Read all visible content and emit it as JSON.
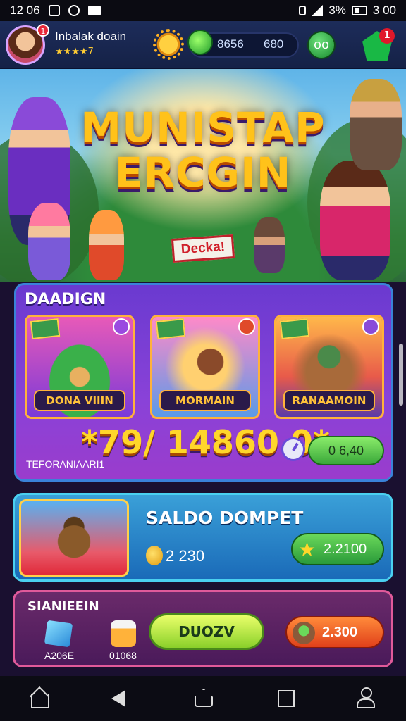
{
  "status_bar": {
    "time": "12 06",
    "battery_pct": "3%",
    "clock_right": "3 00"
  },
  "header": {
    "player_name": "Inbalak doain",
    "player_rating": "★★★★7",
    "avatar_badge": "1",
    "gem_count": "8656",
    "coin_count": "680",
    "friends_icon": "oo",
    "shop_badge": "1"
  },
  "hero": {
    "title_line1": "MUNISTAP",
    "title_line2": "ERCGIN",
    "demo_badge": "Decka!"
  },
  "games_panel": {
    "title": "DAADIGN",
    "games": [
      {
        "label": "DONA VIIIN",
        "icon": "slot-machine-icon"
      },
      {
        "label": "MORMAIN",
        "icon": "adventure-icon"
      },
      {
        "label": "RANAAMOIN",
        "icon": "warrior-icon"
      }
    ],
    "jackpot_amount": "*79/ 14860 0*",
    "jackpot_subtitle": "TEFORANIAARI1",
    "jackpot_button": "0 6,40"
  },
  "wallet": {
    "title": "SALDO DOMPET",
    "balance": "2 230",
    "button_value": "2.2100"
  },
  "shop": {
    "title": "SIANIEEIN",
    "item1_label": "A206E",
    "item2_label": "01068",
    "deposit_button": "DUOZV",
    "price_button": "2.300"
  },
  "colors": {
    "accent_gold": "#ffc21a",
    "panel_purple": "#8a42d8",
    "wallet_blue": "#1a6ab8",
    "shop_magenta": "#6a2a6a"
  }
}
